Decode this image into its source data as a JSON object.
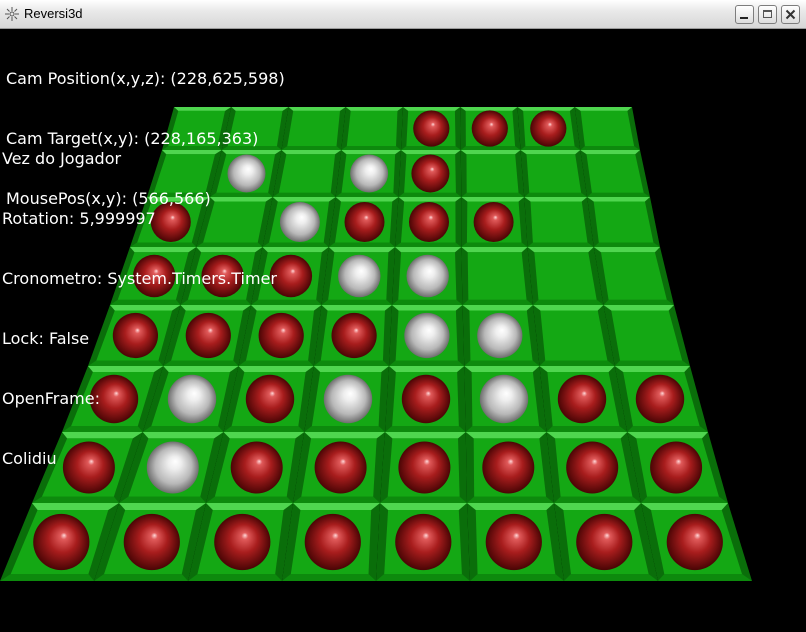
{
  "window": {
    "title": "Reversi3d",
    "icon": "app-icon",
    "controls": [
      "minimize-icon",
      "maximize-icon",
      "close-icon"
    ]
  },
  "hud": {
    "cam_position": "Cam Position(x,y,z): (228,625,598)",
    "cam_target": "Cam Target(x,y): (228,165,363)",
    "mouse_pos": "MousePos(x,y): (566,566)",
    "turn": "Vez do Jogador",
    "rotation": "Rotation: 5,999997",
    "cronometro": "Cronometro: System.Timers.Timer",
    "lock": "Lock: False",
    "open_frame": "OpenFrame:",
    "collision": "Colidiu"
  },
  "colors": {
    "board_green": "#14a814",
    "board_edge": "#0a6e0a",
    "red_piece": "#a81d1d",
    "white_piece": "#d8d8d8"
  },
  "board": {
    "size": 8,
    "legend": "R = red piece, W = white piece, . = empty (row 1 = far side)",
    "rows": [
      "....RRR.",
      ".W.WR...",
      "R.WRRR..",
      "RRRWW...",
      "RRRRWW..",
      "RWRWRWRR",
      "RWRRRRRR",
      "RRRRRRRR"
    ]
  }
}
